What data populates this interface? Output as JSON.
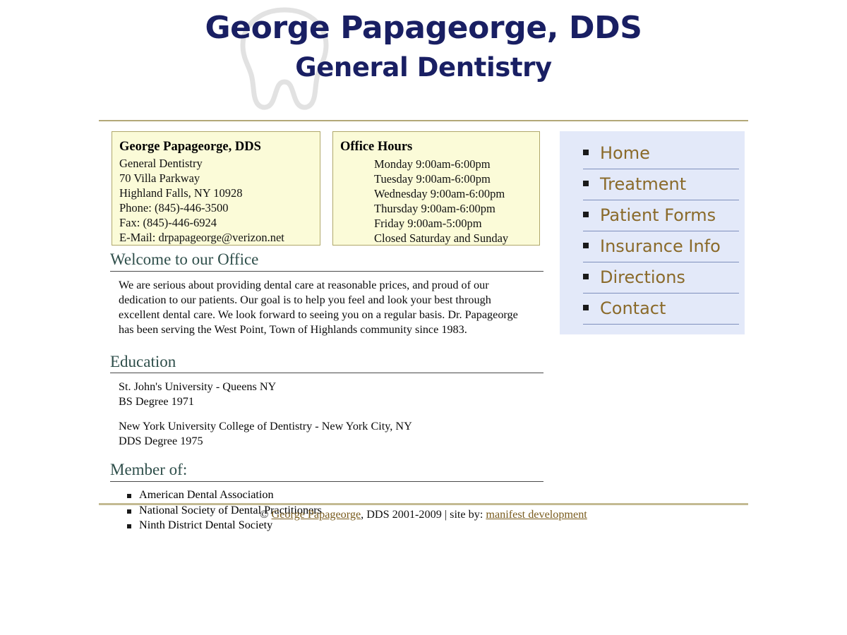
{
  "header": {
    "title": "George Papageorge, DDS",
    "subtitle": "General Dentistry",
    "watermark_icon": "tooth-icon",
    "title_color": "#191f63",
    "rule_color": "#b3a878"
  },
  "contact_box": {
    "title": "George Papageorge, DDS",
    "lines": [
      "General Dentistry",
      "70 Villa Parkway",
      "Highland Falls, NY 10928",
      "Phone: (845)-446-3500",
      "Fax: (845)-446-6924",
      "E-Mail: drpapageorge@verizon.net"
    ],
    "background": "#fbfbd8",
    "border_color": "#b0a86a"
  },
  "hours_box": {
    "title": "Office Hours",
    "lines": [
      "Monday 9:00am-6:00pm",
      "Tuesday 9:00am-6:00pm",
      "Wednesday 9:00am-6:00pm",
      "Thursday 9:00am-6:00pm",
      "Friday 9:00am-5:00pm",
      "Closed Saturday and Sunday"
    ],
    "background": "#fbfbd8",
    "border_color": "#b0a86a"
  },
  "welcome": {
    "heading": "Welcome to our Office",
    "paragraph": "We are serious about providing dental care at reasonable prices, and proud of our dedication to our patients. Our goal is to help you feel and look your best through excellent dental care. We look forward to seeing you on a regular basis. Dr. Papageorge has been serving the West Point, Town of Highlands community since 1983."
  },
  "education": {
    "heading": "Education",
    "entries": [
      {
        "school": "St. John's University - Queens NY",
        "degree": "BS Degree 1971"
      },
      {
        "school": "New York University College of Dentistry - New York City, NY",
        "degree": "DDS Degree 1975"
      }
    ]
  },
  "memberships": {
    "heading": "Member of:",
    "items": [
      "American Dental Association",
      "National Society of Dental Practitioners",
      "Ninth District Dental Society"
    ]
  },
  "nav": {
    "background": "#e3e9f9",
    "link_color": "#8a6a2a",
    "items": [
      {
        "label": "Home"
      },
      {
        "label": "Treatment"
      },
      {
        "label": "Patient Forms"
      },
      {
        "label": "Insurance Info"
      },
      {
        "label": "Directions"
      },
      {
        "label": "Contact"
      }
    ]
  },
  "footer": {
    "copyright_symbol": "© ",
    "owner_link": "George Papageorge",
    "middle_text": ", DDS 2001-2009 | site by: ",
    "credit_link": "manifest development",
    "rule_color": "#c3ba92"
  }
}
